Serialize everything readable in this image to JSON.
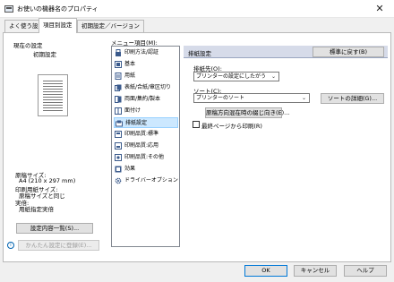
{
  "window": {
    "title": "お使いの機器名のプロパティ",
    "close_glyph": "✕"
  },
  "tabs": [
    {
      "label": "よく使う設定"
    },
    {
      "label": "項目別設定"
    },
    {
      "label": "初期設定／バージョン"
    }
  ],
  "status": {
    "current_settings_label": "現在の設定",
    "preset_name": "初期設定",
    "summary": {
      "paper_size_label": "原稿サイズ:",
      "paper_size_value": "A4 (210 x 297 mm)",
      "print_paper_label": "印刷用紙サイズ:",
      "print_paper_value": "原稿サイズと同じ",
      "tray_label": "実倍:",
      "tray_value": "用紙指定実倍"
    },
    "details_button": "設定内容一覧(S)...",
    "register_button": "かんたん設定に登録(E)...",
    "info_glyph": "i"
  },
  "menu": {
    "label": "メニュー項目(M):",
    "items": [
      {
        "label": "印刷方法/認証"
      },
      {
        "label": "基本"
      },
      {
        "label": "用紙"
      },
      {
        "label": "表紙/合紙/章区切り"
      },
      {
        "label": "両面/集約/製本"
      },
      {
        "label": "面付け"
      },
      {
        "label": "排紙設定"
      },
      {
        "label": "印刷品質:標準"
      },
      {
        "label": "印刷品質:応用"
      },
      {
        "label": "印刷品質:その他"
      },
      {
        "label": "効果"
      },
      {
        "label": "ドライバーオプション"
      }
    ],
    "selected_index": 6
  },
  "detail": {
    "header_title": "排紙設定",
    "reset_button": "標準に戻す(B)",
    "output_label": "排紙先(O):",
    "output_value": "プリンターの設定にしたがう",
    "sort_label": "ソート(C):",
    "sort_value": "プリンターのソート",
    "sort_details_button": "ソートの詳細(G)...",
    "staple_button": "原稿方向混在時の綴じ向き(E)...",
    "last_page_checkbox": "最終ページから印刷(R)",
    "last_page_checked": false
  },
  "footer": {
    "ok": "OK",
    "cancel": "キャンセル",
    "help": "ヘルプ"
  },
  "colors": {
    "selection": "#cce8ff",
    "header_bg": "#d6dbe9",
    "accent": "#0078d7"
  }
}
